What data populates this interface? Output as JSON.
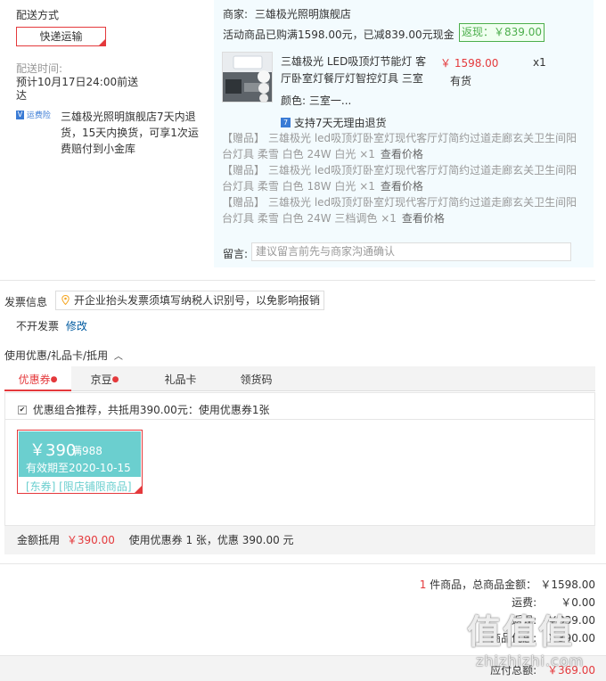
{
  "delivery": {
    "title": "配送方式",
    "method": "快递运输",
    "time_label": "配送时间:",
    "time_value_line1": "预计10月17日24:00前送",
    "time_value_line2": "达",
    "insurance_badge": "运费险",
    "policy_line1": "三雄极光照明旗舰店7天内退",
    "policy_line2": "货，15天内换货，可享1次运",
    "policy_line3": "费赔付到小金库"
  },
  "order": {
    "merchant_label": "商家:",
    "merchant_name": "三雄极光照明旗舰店",
    "promo_text": "活动商品已购满1598.00元，已减839.00元现金",
    "rebate": "返现：￥839.00",
    "product_title_line1": "三雄极光 LED吸顶灯节能灯 客",
    "product_title_line2": "厅卧室灯餐厅灯智控灯具 三室",
    "price": "￥ 1598.00",
    "qty": "x1",
    "stock": "有货",
    "color_label": "颜色:",
    "color_value": "三室一...",
    "return_policy": "支持7天无理由退货",
    "gifts": [
      {
        "tag": "【赠品】",
        "line1": "三雄极光 led吸顶灯卧室灯现代客厅灯简约过道走廊玄关卫生间阳",
        "line2": "台灯具 柔雪 白色 24W 白光 ×1",
        "link": "查看价格"
      },
      {
        "tag": "【赠品】",
        "line1": "三雄极光 led吸顶灯卧室灯现代客厅灯简约过道走廊玄关卫生间阳",
        "line2": "台灯具 柔雪 白色 18W 白光 ×1",
        "link": "查看价格"
      },
      {
        "tag": "【赠品】",
        "line1": "三雄极光 led吸顶灯卧室灯现代客厅灯简约过道走廊玄关卫生间阳",
        "line2": "台灯具 柔雪 白色 24W 三档调色 ×1",
        "link": "查看价格"
      }
    ],
    "message_label": "留言:",
    "message_placeholder": "建议留言前先与商家沟通确认"
  },
  "invoice": {
    "title": "发票信息",
    "tip": "开企业抬头发票须填写纳税人识别号，以免影响报销",
    "value": "不开发票",
    "edit": "修改"
  },
  "discounts": {
    "title": "使用优惠/礼品卡/抵用",
    "tabs": [
      "优惠券",
      "京豆",
      "礼品卡",
      "领货码"
    ],
    "recommend": "优惠组合推荐，共抵用390.00元：使用优惠券1张",
    "coupon": {
      "amount": "￥390",
      "condition": "满988",
      "expiry": "有效期至2020-10-15",
      "tags": "[东券] [限店铺限商品]"
    },
    "summary_label": "金额抵用",
    "summary_amount": "￥390.00",
    "summary_detail": "使用优惠券 1 张，优惠 390.00 元"
  },
  "totals": {
    "count": "1",
    "count_label": "件商品，总商品金额：",
    "goods_total": "￥1598.00",
    "shipping_label": "运费:",
    "shipping": "￥0.00",
    "row3_label": "返现:",
    "row3": "-￥839.00",
    "row4_label": "商品优惠:",
    "row4": "-￥390.00",
    "payable_label": "应付总额:",
    "payable": "￥369.00"
  },
  "watermark": {
    "text": "值值值",
    "url": "zhizhizhi.com"
  }
}
